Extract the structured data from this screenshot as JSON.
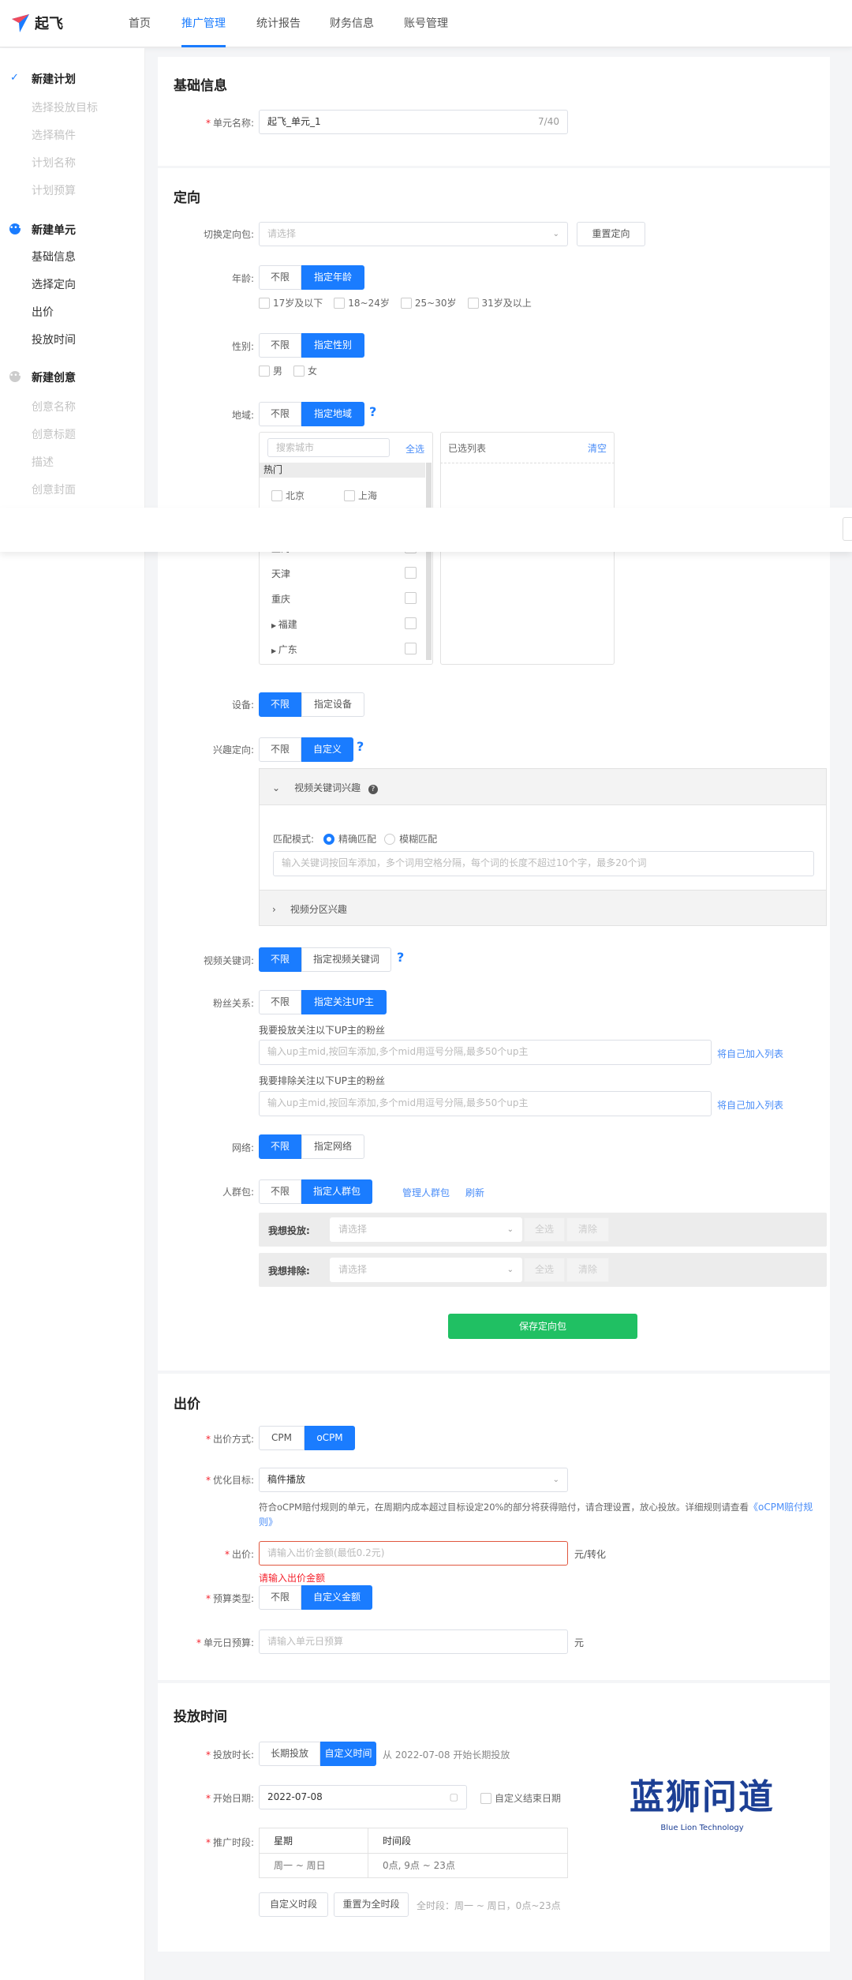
{
  "header": {
    "logo": "起飞",
    "nav": [
      "首页",
      "推广管理",
      "统计报告",
      "财务信息",
      "账号管理"
    ],
    "active": 1
  },
  "sidebar": {
    "groups": [
      {
        "title": "新建计划",
        "status": "done",
        "items": [
          "选择投放目标",
          "选择稿件",
          "计划名称",
          "计划预算"
        ]
      },
      {
        "title": "新建单元",
        "status": "current",
        "items": [
          "基础信息",
          "选择定向",
          "出价",
          "投放时间"
        ]
      },
      {
        "title": "新建创意",
        "status": "pending",
        "items": [
          "创意名称",
          "创意标题",
          "描述",
          "创意封面"
        ]
      }
    ]
  },
  "basic": {
    "title": "基础信息",
    "name_label": "单元名称:",
    "name_value": "起飞_单元_1",
    "name_count": "7/40"
  },
  "targeting": {
    "title": "定向",
    "package_label": "切换定向包:",
    "package_placeholder": "请选择",
    "reset": "重置定向",
    "age_label": "年龄:",
    "unlimited": "不限",
    "age_specify": "指定年龄",
    "ages": [
      "17岁及以下",
      "18~24岁",
      "25~30岁",
      "31岁及以上"
    ],
    "gender_label": "性别:",
    "gender_specify": "指定性别",
    "genders": [
      "男",
      "女"
    ],
    "region_label": "地域:",
    "region_specify": "指定地域",
    "region_search": "搜索城市",
    "select_all": "全选",
    "selected_list": "已选列表",
    "clear": "清空",
    "hot": "热门",
    "hot_cities": [
      "北京",
      "上海"
    ],
    "cities": [
      "上海",
      "天津",
      "重庆",
      "福建",
      "广东"
    ],
    "device_label": "设备:",
    "device_specify": "指定设备",
    "interest_label": "兴趣定向:",
    "interest_custom": "自定义",
    "panel1": "视频关键词兴趣",
    "match_label": "匹配模式:",
    "match_exact": "精确匹配",
    "match_fuzzy": "模糊匹配",
    "keyword_placeholder": "输入关键词按回车添加，多个词用空格分隔，每个词的长度不超过10个字，最多20个词",
    "panel2": "视频分区兴趣",
    "vkw_label": "视频关键词:",
    "vkw_specify": "指定视频关键词",
    "fans_label": "粉丝关系:",
    "fans_specify": "指定关注UP主",
    "fans_include": "我要投放关注以下UP主的粉丝",
    "fans_exclude": "我要排除关注以下UP主的粉丝",
    "fans_placeholder": "输入up主mid,按回车添加,多个mid用逗号分隔,最多50个up主",
    "add_self": "将自己加入列表",
    "network_label": "网络:",
    "network_specify": "指定网络",
    "crowd_label": "人群包:",
    "crowd_specify": "指定人群包",
    "manage_crowd": "管理人群包",
    "refresh": "刷新",
    "want_include": "我想投放:",
    "want_exclude": "我想排除:",
    "select_placeholder": "请选择",
    "clear_btn": "清除",
    "save": "保存定向包"
  },
  "bid": {
    "title": "出价",
    "method_label": "出价方式:",
    "cpm": "CPM",
    "ocpm": "oCPM",
    "goal_label": "优化目标:",
    "goal_value": "稿件播放",
    "note": "符合oCPM赔付规则的单元，在周期内成本超过目标设定20%的部分将获得赔付，请合理设置，放心投放。详细规则请查看",
    "note_link": "《oCPM赔付规则》",
    "price_label": "出价:",
    "price_placeholder": "请输入出价金额(最低0.2元)",
    "price_unit": "元/转化",
    "price_error": "请输入出价金额",
    "budget_type_label": "预算类型:",
    "budget_custom": "自定义金额",
    "daily_label": "单元日预算:",
    "daily_placeholder": "请输入单元日预算",
    "daily_unit": "元"
  },
  "schedule": {
    "title": "投放时间",
    "duration_label": "投放时长:",
    "long_term": "长期投放",
    "custom_time": "自定义时间",
    "duration_note": "从 2022-07-08 开始长期投放",
    "start_label": "开始日期:",
    "start_value": "2022-07-08",
    "custom_end": "自定义结束日期",
    "period_label": "推广时段:",
    "col_week": "星期",
    "col_time": "时间段",
    "row_week": "周一 ~ 周日",
    "row_time": "0点, 9点 ~ 23点",
    "custom_period": "自定义时段",
    "reset_period": "重置为全时段",
    "full_note": "全时段：周一 ~ 周日，0点~23点"
  },
  "watermark": {
    "cn": "蓝狮问道",
    "en": "Blue Lion Technology"
  },
  "colors": {
    "primary": "#1a7cff",
    "success": "#20c063",
    "error": "#f5222d"
  }
}
